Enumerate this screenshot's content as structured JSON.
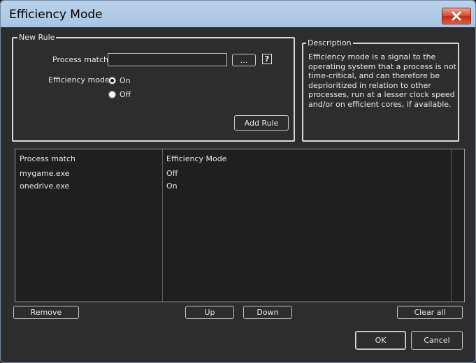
{
  "window": {
    "title": "Efficiency Mode"
  },
  "new_rule": {
    "legend": "New Rule",
    "process_match_label": "Process match:",
    "process_match_value": "",
    "browse_label": "...",
    "help_label": "?",
    "efficiency_mode_label": "Efficiency mode:",
    "option_on": "On",
    "option_off": "Off",
    "selected": "On",
    "add_rule_label": "Add Rule"
  },
  "description": {
    "legend": "Description",
    "text": "Efficiency mode is a signal to the operating system that a process is not time-critical, and can therefore be deprioritized in relation to other processes, run at a lesser clock speed and/or on efficient cores, if available."
  },
  "table": {
    "columns": [
      "Process match",
      "Efficiency Mode"
    ],
    "rows": [
      {
        "process": "mygame.exe",
        "mode": "Off"
      },
      {
        "process": "onedrive.exe",
        "mode": "On"
      }
    ]
  },
  "buttons": {
    "remove": "Remove",
    "up": "Up",
    "down": "Down",
    "clear_all": "Clear all",
    "ok": "OK",
    "cancel": "Cancel"
  },
  "icons": {
    "close": "close-icon"
  }
}
